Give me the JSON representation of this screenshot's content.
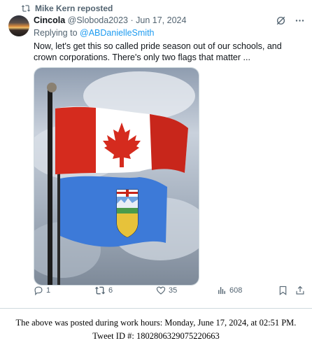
{
  "repost": {
    "label": "Mike Kern reposted"
  },
  "tweet": {
    "display_name": "Cincola",
    "handle": "@Sloboda2023",
    "separator": "·",
    "date": "Jun 17, 2024",
    "replying_prefix": "Replying to",
    "replying_to": "@ABDanielleSmith",
    "text": "Now, let's get this so called pride season out of our schools, and crown corporations. There's only two flags that matter ..."
  },
  "actions": {
    "replies": "1",
    "reposts": "6",
    "likes": "35",
    "views": "608"
  },
  "caption": {
    "line1": "The above was posted during work hours: Monday, June 17, 2024, at 02:51 PM.",
    "line2": "Tweet ID #: 1802806329075220663"
  },
  "icons": {
    "repost": "repost-icon",
    "grok": "grok-icon",
    "more": "more-icon",
    "reply": "reply-icon",
    "like": "heart-icon",
    "views": "views-icon",
    "bookmark": "bookmark-icon",
    "share": "share-icon"
  },
  "colors": {
    "accent": "#1d9bf0",
    "secondary_text": "#536471",
    "canada_red": "#d52b1e",
    "alberta_blue": "#3d7ad8"
  }
}
